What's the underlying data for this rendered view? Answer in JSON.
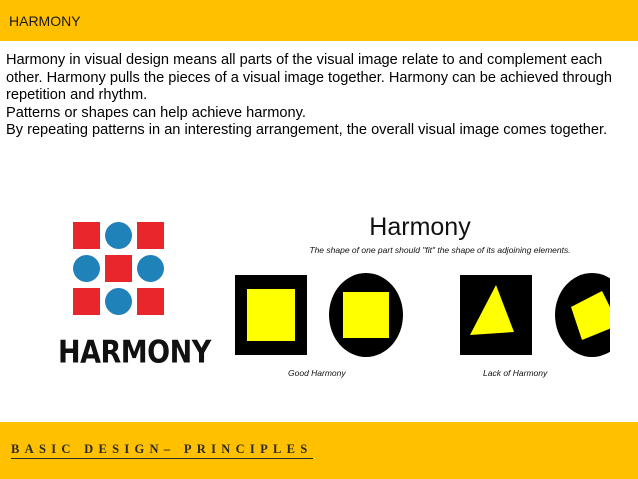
{
  "header": {
    "title": "HARMONY"
  },
  "body": {
    "paragraphs": [
      "Harmony in visual design means all parts of the visual image relate to and complement each other. Harmony pulls the pieces of a visual image together. Harmony can be achieved through repetition and rhythm.",
      "Patterns or shapes can help achieve harmony.",
      "By repeating patterns in an interesting arrangement, the overall visual image comes together."
    ]
  },
  "logo": {
    "text": "HARMONY",
    "colors": {
      "square": "#e8262c",
      "circle": "#1f82b8"
    }
  },
  "illustration": {
    "title": "Harmony",
    "subtitle": "The shape of one part should \"fit\" the shape of its adjoining elements.",
    "good_caption": "Good Harmony",
    "lack_caption": "Lack of Harmony",
    "colors": {
      "fill": "#ffff00",
      "frame": "#000000"
    }
  },
  "footer": {
    "text": "BASIC DESIGN– PRINCIPLES"
  },
  "theme": {
    "accent": "#ffc000"
  }
}
